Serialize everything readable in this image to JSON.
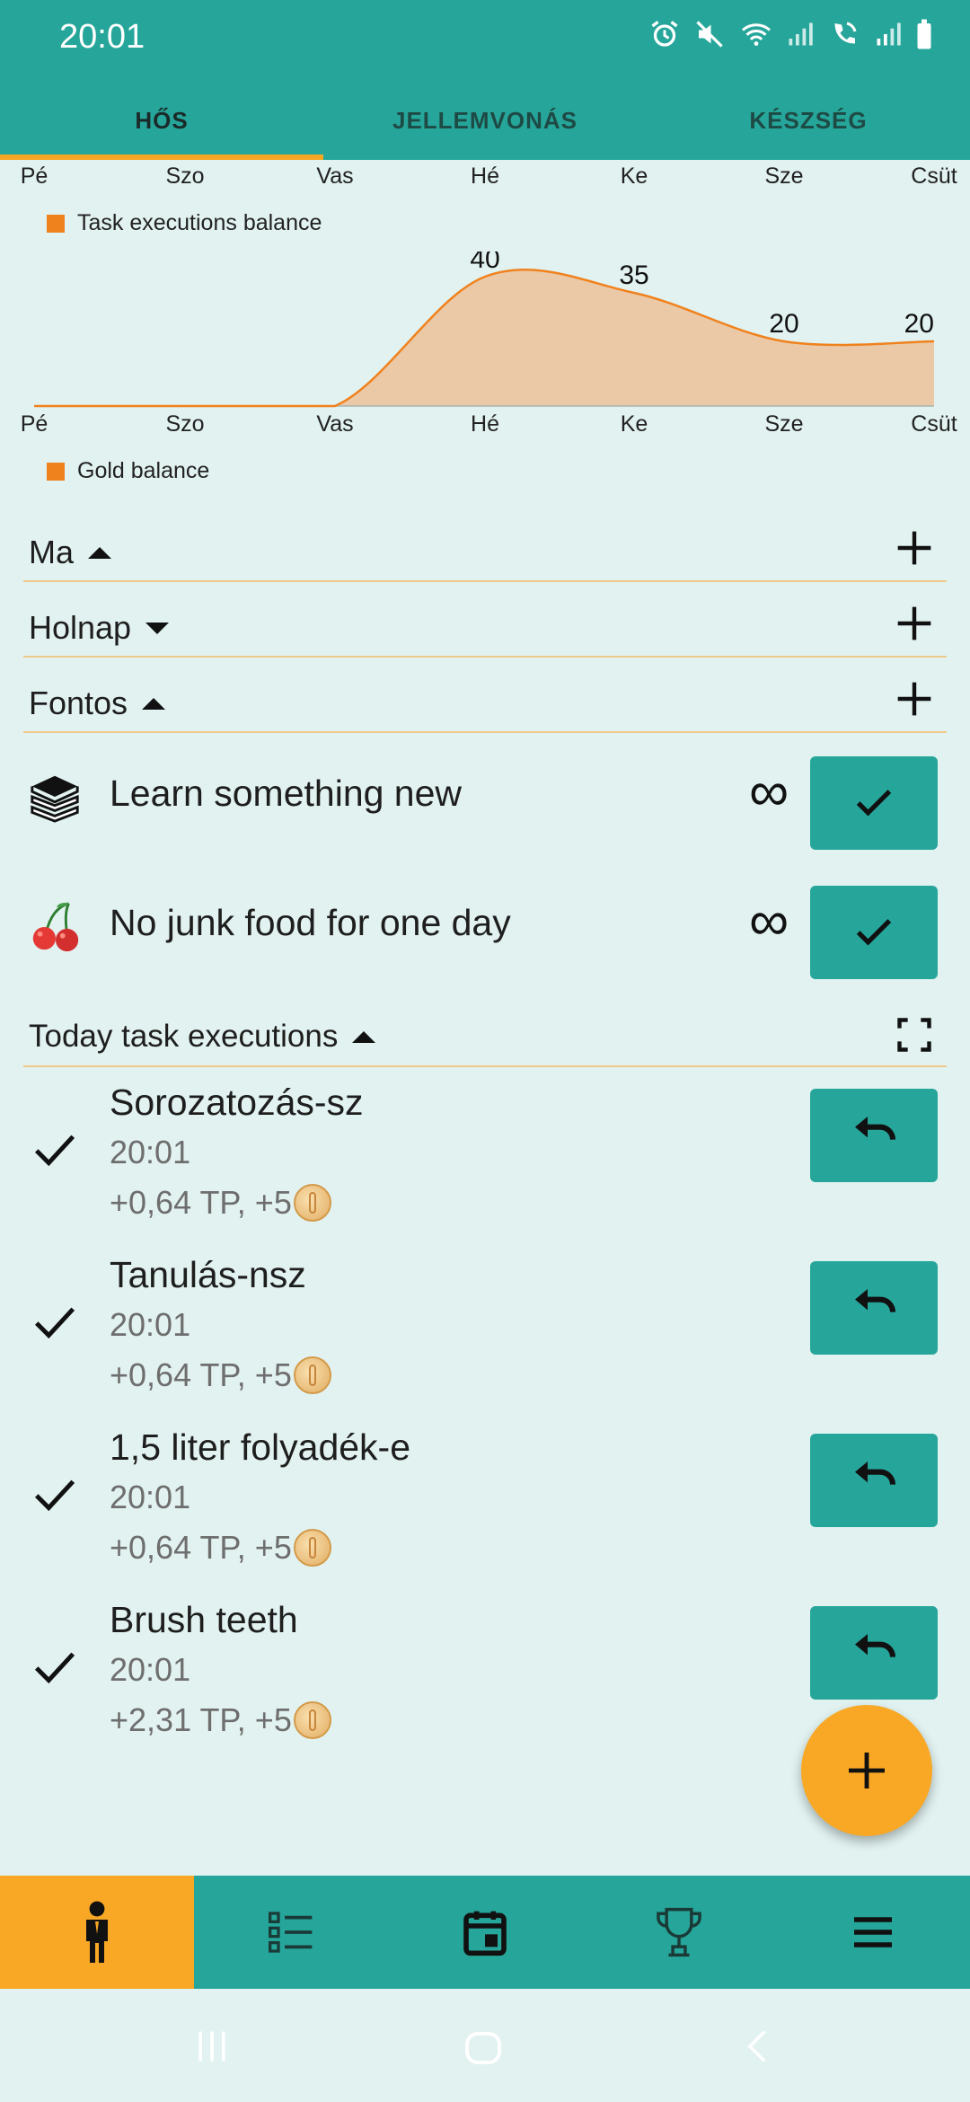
{
  "status_bar": {
    "time": "20:01",
    "icons": [
      "alarm-icon",
      "mute-icon",
      "wifi-icon",
      "signal-icon",
      "wifi-calling-icon",
      "signal-icon-2",
      "battery-icon"
    ]
  },
  "tabs": [
    {
      "label": "HŐS",
      "active": true
    },
    {
      "label": "JELLEMVONÁS",
      "active": false
    },
    {
      "label": "KÉSZSÉG",
      "active": false
    }
  ],
  "chart_days": [
    "Pé",
    "Szo",
    "Vas",
    "Hé",
    "Ke",
    "Sze",
    "Csüt"
  ],
  "legends": {
    "task_executions": "Task executions balance",
    "gold": "Gold balance"
  },
  "chart_data": {
    "type": "area",
    "categories": [
      "Pé",
      "Szo",
      "Vas",
      "Hé",
      "Ke",
      "Sze",
      "Csüt"
    ],
    "series": [
      {
        "name": "Task executions balance",
        "values": [
          0,
          0,
          0,
          0,
          0,
          0,
          0
        ]
      },
      {
        "name": "Gold balance",
        "values": [
          0,
          0,
          0,
          40,
          35,
          20,
          20
        ]
      }
    ],
    "data_labels": [
      "40",
      "35",
      "20",
      "20"
    ],
    "colors": {
      "line": "#f0821e",
      "fill": "#ebc9a6"
    },
    "ylim": [
      0,
      45
    ],
    "grid": false
  },
  "sections": {
    "today": "Ma",
    "tomorrow": "Holnap",
    "important": "Fontos",
    "executions": "Today task executions"
  },
  "habits": [
    {
      "label": "Learn something new",
      "icon": "books-icon",
      "limit": "∞"
    },
    {
      "label": "No junk food for one day",
      "icon": "cherries-icon",
      "limit": "∞"
    }
  ],
  "executions": [
    {
      "title": "Sorozatozás-sz",
      "time": "20:01",
      "reward": "+0,64 TP, +5"
    },
    {
      "title": "Tanulás-nsz",
      "time": "20:01",
      "reward": "+0,64 TP, +5"
    },
    {
      "title": "1,5 liter folyadék-e",
      "time": "20:01",
      "reward": "+0,64 TP, +5"
    },
    {
      "title": "Brush teeth",
      "time": "20:01",
      "reward": "+2,31 TP, +5"
    }
  ],
  "bottom_nav": [
    "hero-icon",
    "list-icon",
    "calendar-icon",
    "trophy-icon",
    "menu-icon"
  ],
  "colors": {
    "primary": "#26a69a",
    "accent": "#f9a825",
    "background": "#e1f2f0"
  }
}
